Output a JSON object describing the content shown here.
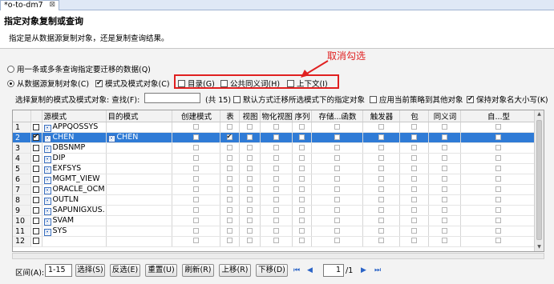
{
  "tab": {
    "label": "*o-to-dm7",
    "close_icon": "close-icon"
  },
  "header": {
    "title": "指定对象复制或查询",
    "description": "指定是从数据源复制对象，还是复制查询结果。"
  },
  "annotation": {
    "text": "取消勾选",
    "color": "#e02020"
  },
  "options": {
    "query_radio": "用一条或多条查询指定要迁移的数据(Q)",
    "copy_radio": "从数据源复制对象(C)",
    "schema_and_objects": "模式及模式对象(C)",
    "catalog": "目录(G)",
    "public_synonym": "公共同义词(H)",
    "context": "上下文(I)"
  },
  "filter": {
    "label": "选择复制的模式及模式对象: 查找(F):",
    "search_value": "",
    "count": "(共 15)",
    "default_migrate": "默认方式迁移所选模式下的指定对象",
    "apply_policy": "应用当前策略到其他对象",
    "keep_case": "保持对象名大小写(K)"
  },
  "table": {
    "columns": [
      "",
      "",
      "源模式",
      "目的模式",
      "创建模式",
      "表",
      "视图",
      "物化视图",
      "序列",
      "存储...函数",
      "触发器",
      "包",
      "同义词",
      "自...型"
    ],
    "rows": [
      {
        "num": "1",
        "checked": false,
        "source": "APPQOSSYS",
        "target": "",
        "flags": []
      },
      {
        "num": "2",
        "checked": true,
        "source": "CHEN",
        "target": "CHEN",
        "flags": [
          "table"
        ]
      },
      {
        "num": "3",
        "checked": false,
        "source": "DBSNMP",
        "target": "",
        "flags": []
      },
      {
        "num": "4",
        "checked": false,
        "source": "DIP",
        "target": "",
        "flags": []
      },
      {
        "num": "5",
        "checked": false,
        "source": "EXFSYS",
        "target": "",
        "flags": []
      },
      {
        "num": "6",
        "checked": false,
        "source": "MGMT_VIEW",
        "target": "",
        "flags": []
      },
      {
        "num": "7",
        "checked": false,
        "source": "ORACLE_OCM",
        "target": "",
        "flags": []
      },
      {
        "num": "8",
        "checked": false,
        "source": "OUTLN",
        "target": "",
        "flags": []
      },
      {
        "num": "9",
        "checked": false,
        "source": "SAPUNIGXUS.",
        "target": "",
        "flags": []
      },
      {
        "num": "10",
        "checked": false,
        "source": "SVAM",
        "target": "",
        "flags": []
      },
      {
        "num": "11",
        "checked": false,
        "source": "SYS",
        "target": "",
        "flags": []
      },
      {
        "num": "12",
        "checked": false,
        "source": "",
        "target": "",
        "flags": []
      }
    ]
  },
  "bottom": {
    "range_label": "区间(A):",
    "range_value": "1-15",
    "select": "选择(S)",
    "invert": "反选(E)",
    "reset": "重置(U)",
    "refresh": "刷新(R)",
    "move_up": "上移(R)",
    "move_down": "下移(D)",
    "page_value": "1",
    "page_total": "/1"
  },
  "colors": {
    "selection": "#2f7bd6",
    "annotation": "#e02020"
  }
}
